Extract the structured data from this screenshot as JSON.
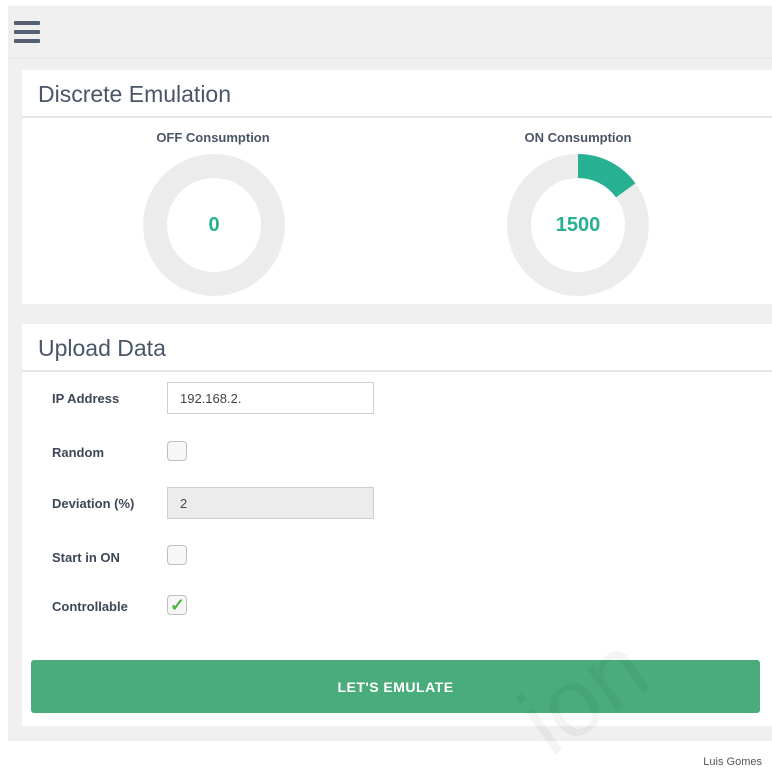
{
  "discrete": {
    "title": "Discrete Emulation",
    "off": {
      "label": "OFF Consumption",
      "value": "0",
      "fraction": 0
    },
    "on": {
      "label": "ON Consumption",
      "value": "1500",
      "fraction": 0.15
    },
    "gauge_color": "#27b092",
    "track_color": "#ececec"
  },
  "upload": {
    "title": "Upload Data",
    "ip": {
      "label": "IP Address",
      "value": "192.168.2."
    },
    "random": {
      "label": "Random",
      "checked": false
    },
    "deviation": {
      "label": "Deviation (%)",
      "value": "2"
    },
    "start_on": {
      "label": "Start in ON",
      "checked": false
    },
    "controllable": {
      "label": "Controllable",
      "checked": true,
      "mark": "✓"
    },
    "button_label": "LET'S EMULATE",
    "button_color": "#4aac7b"
  },
  "footer": {
    "credit": "Luis Gomes"
  },
  "icons": {
    "menu": "hamburger-icon"
  }
}
